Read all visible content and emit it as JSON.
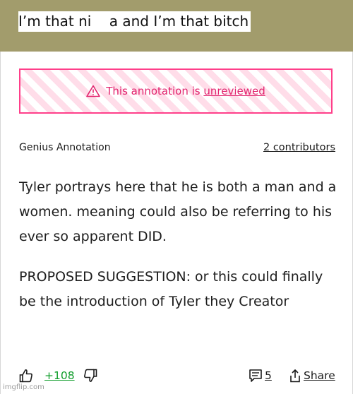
{
  "lyric": {
    "text": "I’m that ni    a and I’m that bitch"
  },
  "warning": {
    "prefix": "This annotation is ",
    "link": "unreviewed",
    "icon": "warning-triangle-icon",
    "color": "#e2246e"
  },
  "annotation": {
    "label": "Genius Annotation",
    "contributors": "2 contributors",
    "paragraphs": [
      "Tyler portrays here that he is both a man and a women. meaning could also be referring to his ever so apparent DID.",
      "PROPOSED SUGGESTION: or this could finally be the introduction of Tyler they Creator"
    ]
  },
  "actions": {
    "upvote_icon": "thumbs-up-icon",
    "votes": "+108",
    "downvote_icon": "thumbs-down-icon",
    "comments_icon": "comment-icon",
    "comments": "5",
    "share_icon": "share-icon",
    "share": "Share"
  },
  "watermark": "imgflip.com",
  "colors": {
    "header_bg": "#a29c6c",
    "vote_green": "#0f9d2a",
    "warning_pink": "#ff3f8a"
  }
}
